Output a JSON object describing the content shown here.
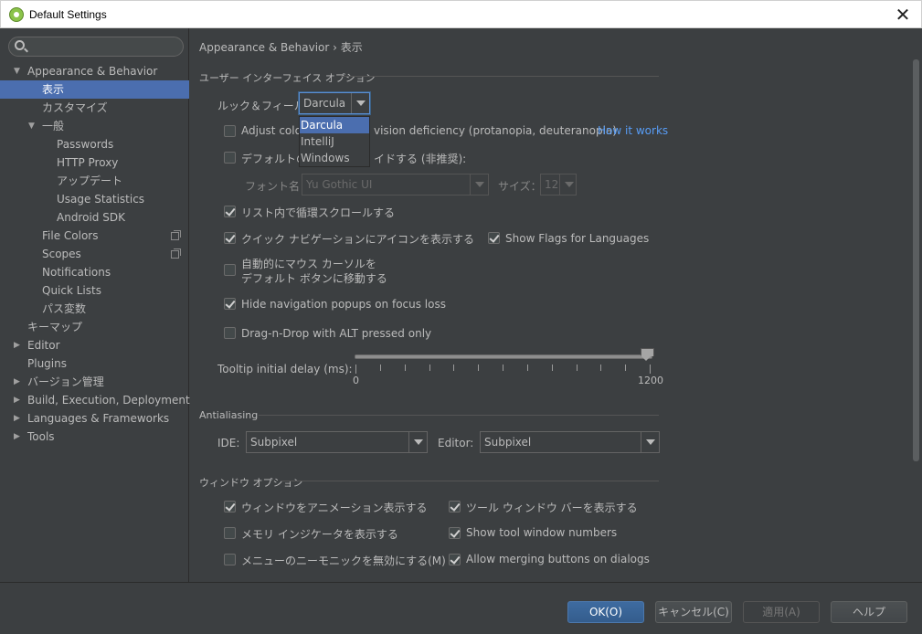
{
  "window": {
    "title": "Default Settings"
  },
  "search": {
    "placeholder": "",
    "value": ""
  },
  "sidebar": {
    "items": [
      {
        "label": "Appearance & Behavior",
        "arrow": "▼"
      },
      {
        "label": "表示"
      },
      {
        "label": "カスタマイズ"
      },
      {
        "label": "一般",
        "arrow": "▼"
      },
      {
        "label": "Passwords"
      },
      {
        "label": "HTTP Proxy"
      },
      {
        "label": "アップデート"
      },
      {
        "label": "Usage Statistics"
      },
      {
        "label": "Android SDK"
      },
      {
        "label": "File Colors"
      },
      {
        "label": "Scopes"
      },
      {
        "label": "Notifications"
      },
      {
        "label": "Quick Lists"
      },
      {
        "label": "パス変数"
      },
      {
        "label": "キーマップ"
      },
      {
        "label": "Editor",
        "arrow": "▶"
      },
      {
        "label": "Plugins"
      },
      {
        "label": "バージョン管理",
        "arrow": "▶"
      },
      {
        "label": "Build, Execution, Deployment",
        "arrow": "▶"
      },
      {
        "label": "Languages & Frameworks",
        "arrow": "▶"
      },
      {
        "label": "Tools",
        "arrow": "▶"
      }
    ]
  },
  "breadcrumb": {
    "parent": "Appearance & Behavior",
    "separator": "›",
    "current": "表示"
  },
  "ui_options": {
    "section_title": "ユーザー インターフェイス オプション",
    "laf_label": "ルック＆フィール：",
    "laf_value": "Darcula",
    "laf_options": [
      "Darcula",
      "IntelliJ",
      "Windows"
    ],
    "adjust_colors_prefix": "Adjust color",
    "adjust_colors_suffix": "vision deficiency (protanopia, deuteranopia)",
    "how_it_works": "How it works",
    "override_font_prefix": "デフォルトのフ",
    "override_font_suffix": "イドする (非推奨):",
    "font_name_label": "フォント名：",
    "font_name_value": "Yu Gothic UI",
    "size_label": "サイズ：",
    "size_value": "12",
    "cyclic_scrolling": "リスト内で循環スクロールする",
    "quick_nav_icons": "クイック ナビゲーションにアイコンを表示する",
    "show_flags": "Show Flags for Languages",
    "auto_mouse_line1": "自動的にマウス カーソルを",
    "auto_mouse_line2": "デフォルト ボタンに移動する",
    "hide_nav_popups": "Hide navigation popups on focus loss",
    "drag_n_drop": "Drag-n-Drop with ALT pressed only",
    "tooltip_delay_label": "Tooltip initial delay (ms):",
    "tooltip_min": "0",
    "tooltip_max": "1200",
    "tooltip_value_fraction": 1.0
  },
  "antialiasing": {
    "section_title": "Antialiasing",
    "ide_label": "IDE:",
    "ide_value": "Subpixel",
    "editor_label": "Editor:",
    "editor_value": "Subpixel"
  },
  "window_options": {
    "section_title": "ウィンドウ オプション",
    "animate_windows": "ウィンドウをアニメーション表示する",
    "show_tool_window_bars": "ツール ウィンドウ バーを表示する",
    "show_memory": "メモリ インジケータを表示する",
    "show_tool_window_numbers": "Show tool window numbers",
    "disable_mnemonics": "メニューのニーモニックを無効にする(M)",
    "allow_merging": "Allow merging buttons on dialogs"
  },
  "footer": {
    "ok": "OK(O)",
    "cancel": "キャンセル(C)",
    "apply": "適用(A)",
    "help": "ヘルプ"
  }
}
